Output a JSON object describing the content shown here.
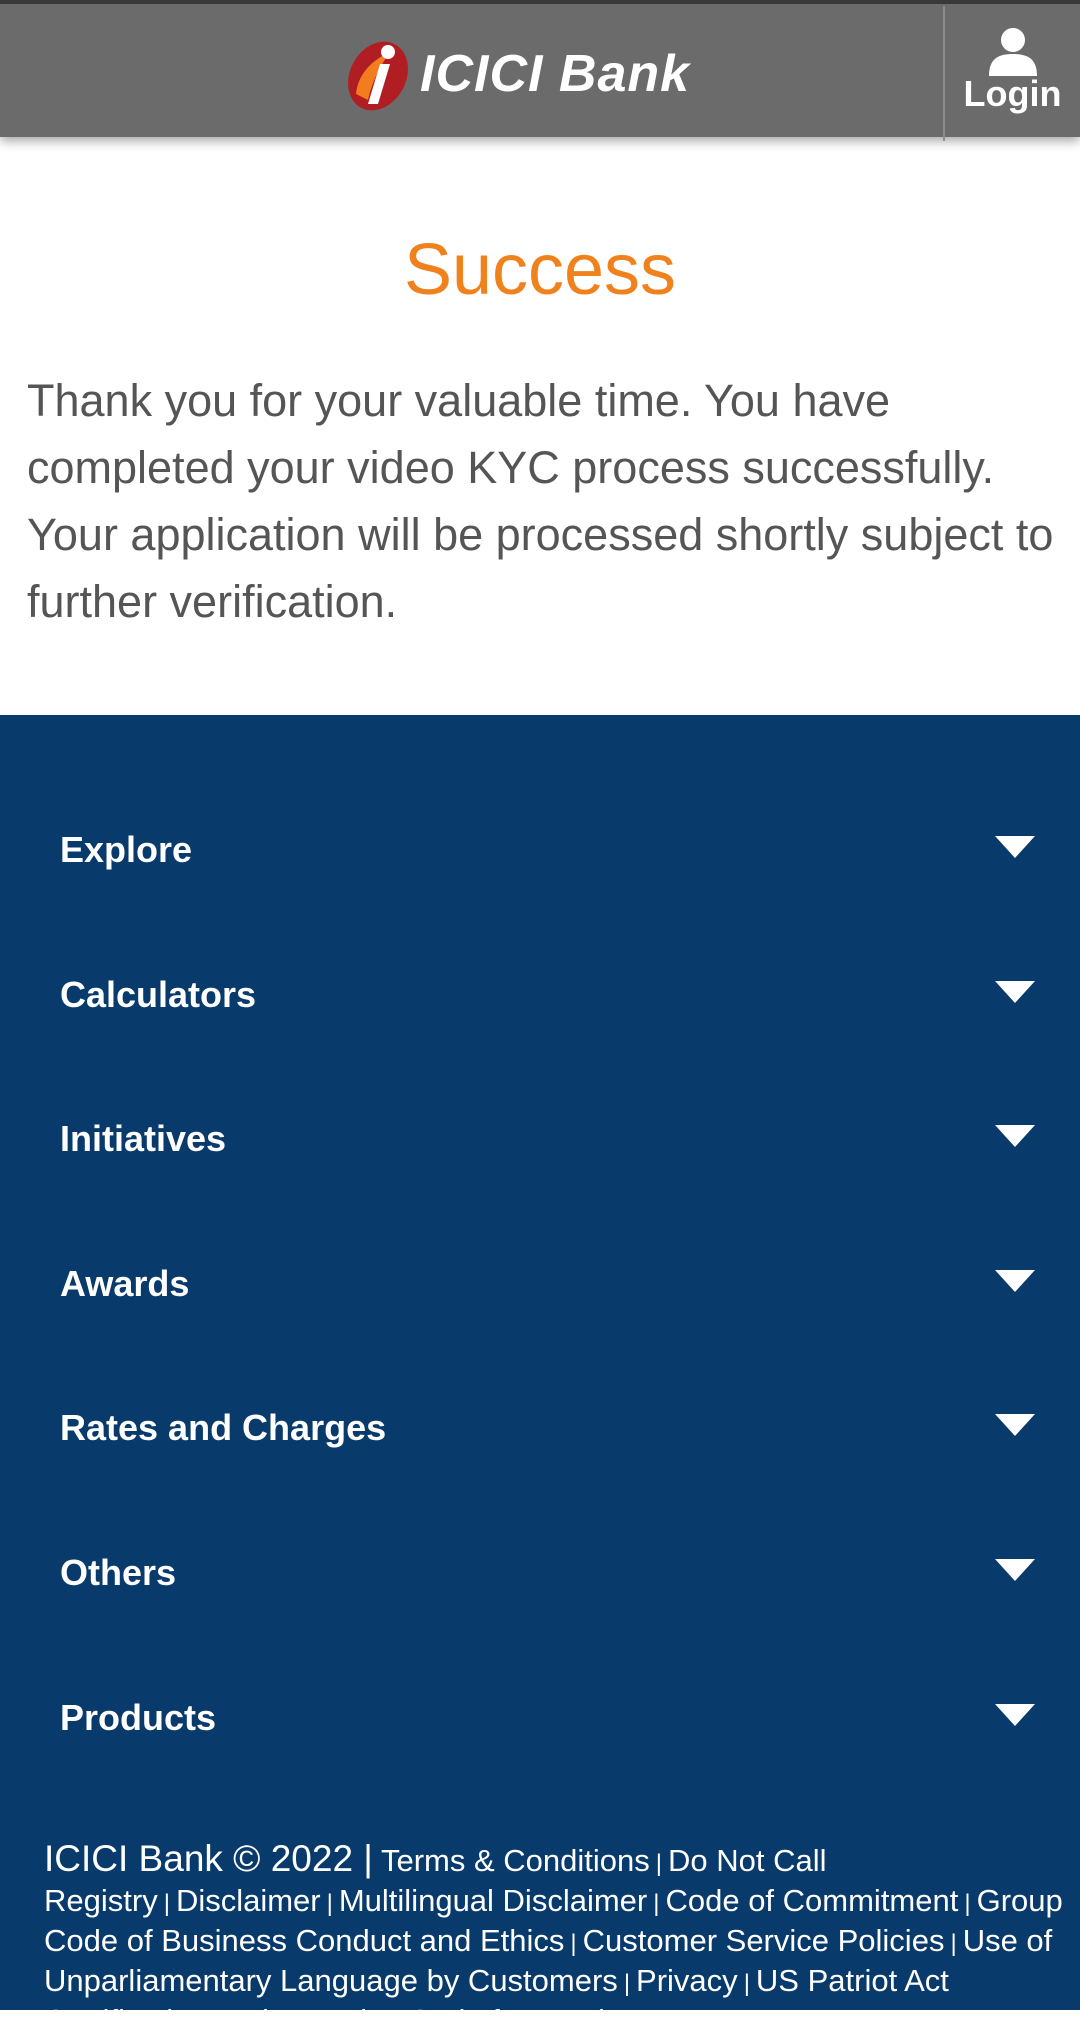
{
  "header": {
    "brand_name": "ICICI Bank",
    "login_label": "Login"
  },
  "content": {
    "title": "Success",
    "message": "Thank you for your valuable time. You have completed your video KYC process successfully. Your application will be processed shortly subject to further verification."
  },
  "footer": {
    "menu": [
      {
        "label": "Explore",
        "icon": "chevron-down-icon"
      },
      {
        "label": "Calculators",
        "icon": "chevron-down-icon"
      },
      {
        "label": "Initiatives",
        "icon": "chevron-down-icon"
      },
      {
        "label": "Awards",
        "icon": "chevron-down-icon"
      },
      {
        "label": "Rates and Charges",
        "icon": "chevron-down-icon"
      },
      {
        "label": "Others",
        "icon": "chevron-down-icon"
      },
      {
        "label": "Products",
        "icon": "chevron-down-icon"
      }
    ],
    "copyright": "ICICI Bank © 2022 |",
    "links": [
      "Terms & Conditions",
      "Do Not Call Registry",
      "Disclaimer",
      "Multilingual Disclaimer",
      "Code of Commitment",
      "Group Code of Business Conduct and Ethics",
      "Customer Service Policies",
      "Use of Unparliamentary Language by Customers",
      "Privacy",
      "US Patriot Act Certification",
      "Fair Practice Code for Lenders"
    ]
  },
  "colors": {
    "header_bg": "#6b6b6b",
    "title": "#f0821e",
    "footer_bg": "#083a6b"
  }
}
